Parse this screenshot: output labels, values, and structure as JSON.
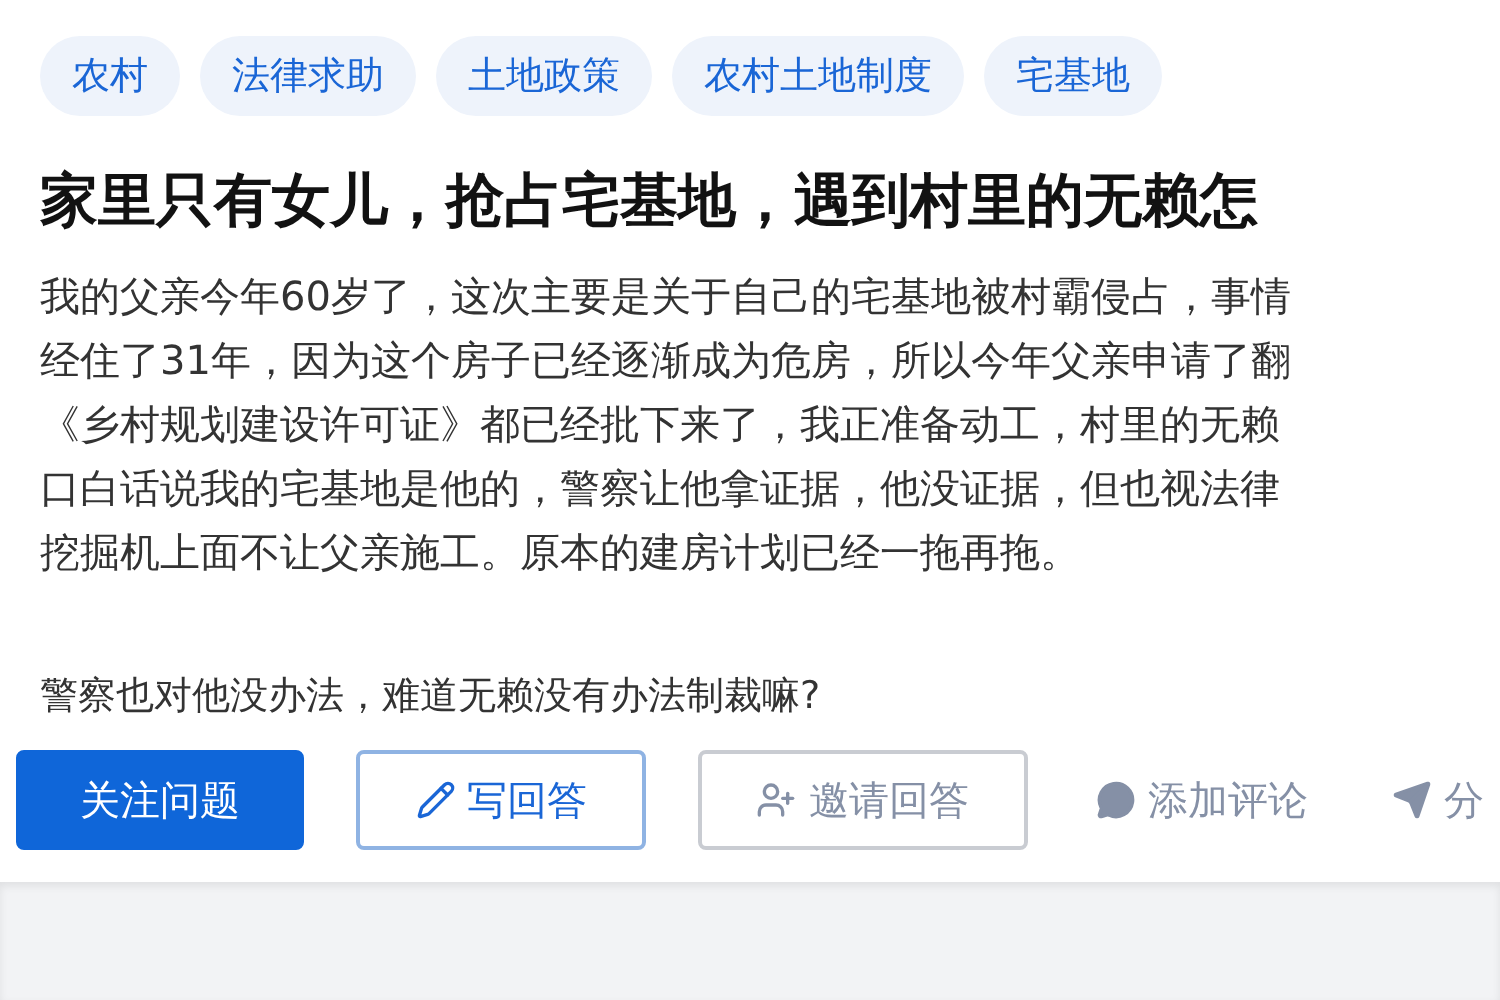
{
  "tags": [
    "农村",
    "法律求助",
    "土地政策",
    "农村土地制度",
    "宅基地"
  ],
  "title": "家里只有女儿，抢占宅基地，遇到村里的无赖怎",
  "body_lines": [
    "我的父亲今年60岁了，这次主要是关于自己的宅基地被村霸侵占，事情",
    "经住了31年，因为这个房子已经逐渐成为危房，所以今年父亲申请了翻",
    "《乡村规划建设许可证》都已经批下来了，我正准备动工，村里的无赖",
    "口白话说我的宅基地是他的，警察让他拿证据，他没证据，但也视法律",
    "挖掘机上面不让父亲施工。原本的建房计划已经一拖再拖。"
  ],
  "question": "警察也对他没办法，难道无赖没有办法制裁嘛?",
  "actions": [
    {
      "kind": "follow",
      "label": "关注问题"
    },
    {
      "kind": "write",
      "label": "写回答"
    },
    {
      "kind": "invite",
      "label": "邀请回答"
    },
    {
      "kind": "comment",
      "label": "添加评论"
    },
    {
      "kind": "share",
      "label": "分"
    }
  ]
}
